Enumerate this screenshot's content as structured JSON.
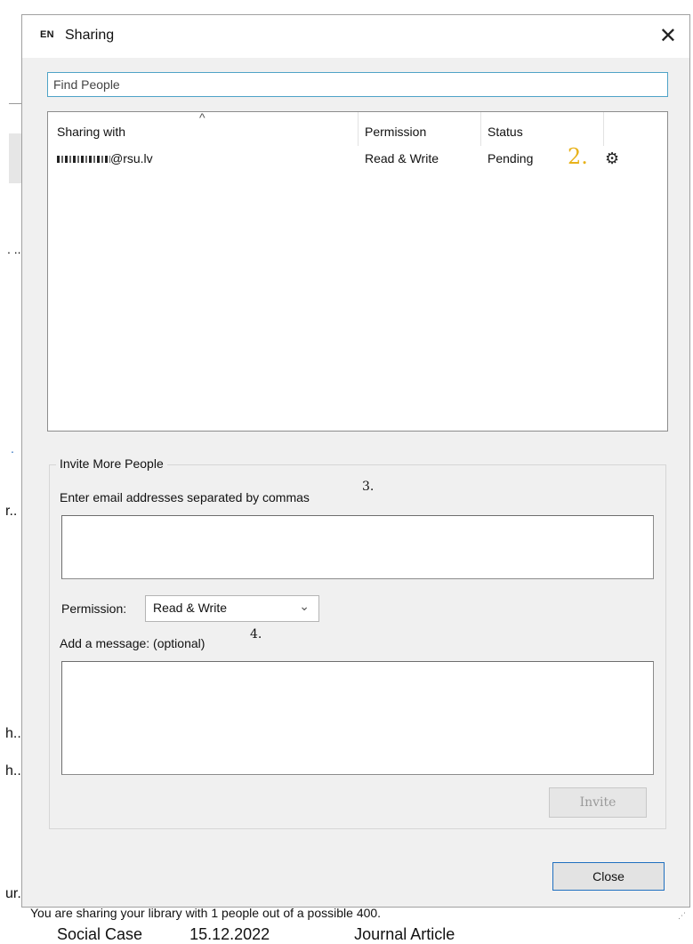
{
  "background": {
    "fragments": [
      "ur.",
      "r..",
      "h..",
      "h...",
      ". ..",
      "."
    ],
    "bottom_row": [
      "Social Case",
      "15.12.2022",
      "Journal Article"
    ]
  },
  "dialog": {
    "app_icon": "EN",
    "title": "Sharing",
    "close_glyph": "✕",
    "find_placeholder": "Find People",
    "list": {
      "headers": {
        "sharing_with": "Sharing with",
        "permission": "Permission",
        "status": "Status"
      },
      "sort_glyph": "^",
      "rows": [
        {
          "email_suffix": "@rsu.lv",
          "permission": "Read & Write",
          "status": "Pending",
          "annotation": "2.",
          "gear": "⚙"
        }
      ]
    },
    "invite": {
      "group_title": "Invite More People",
      "email_label": "Enter email addresses separated by commas",
      "email_annotation": "3.",
      "permission_label": "Permission:",
      "permission_value": "Read & Write",
      "message_label": "Add a message: (optional)",
      "message_annotation": "4.",
      "invite_button": "Invite"
    },
    "close_button": "Close",
    "status_text": "You are sharing your library with 1 people out of a possible 400."
  }
}
